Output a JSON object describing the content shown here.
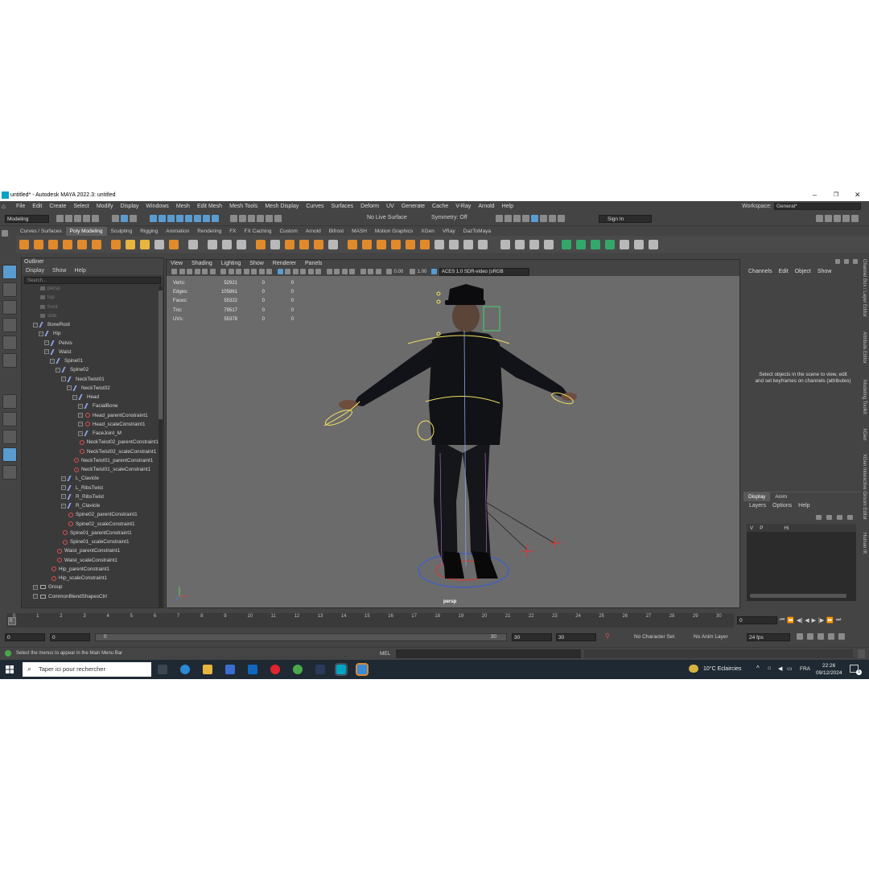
{
  "window": {
    "title": "untitled* - Autodesk MAYA 2022.3: untitled"
  },
  "menubar": {
    "items": [
      "File",
      "Edit",
      "Create",
      "Select",
      "Modify",
      "Display",
      "Windows",
      "Mesh",
      "Edit Mesh",
      "Mesh Tools",
      "Mesh Display",
      "Curves",
      "Surfaces",
      "Deform",
      "UV",
      "Generate",
      "Cache",
      "V-Ray",
      "Arnold",
      "Help"
    ],
    "workspace_label": "Workspace:",
    "workspace_value": "General*"
  },
  "statusline": {
    "mode": "Modeling",
    "live_surface": "No Live Surface",
    "symmetry": "Symmetry: Off",
    "sign_in": "Sign In"
  },
  "shelf": {
    "tabs": [
      "Curves / Surfaces",
      "Poly Modeling",
      "Sculpting",
      "Rigging",
      "Animation",
      "Rendering",
      "FX",
      "FX Caching",
      "Custom",
      "Arnold",
      "Bifrost",
      "MASH",
      "Motion Graphics",
      "XGen",
      "VRay",
      "DazToMaya"
    ],
    "active_tab": "Poly Modeling"
  },
  "outliner": {
    "title": "Outliner",
    "menu": [
      "Display",
      "Show",
      "Help"
    ],
    "search_placeholder": "Search...",
    "items": [
      {
        "label": "persp",
        "depth": 0,
        "kind": "camera",
        "dim": true
      },
      {
        "label": "top",
        "depth": 0,
        "kind": "camera",
        "dim": true
      },
      {
        "label": "front",
        "depth": 0,
        "kind": "camera",
        "dim": true
      },
      {
        "label": "side",
        "depth": 0,
        "kind": "camera",
        "dim": true
      },
      {
        "label": "BoneRoot",
        "depth": 0,
        "kind": "joint",
        "exp": true
      },
      {
        "label": "Hip",
        "depth": 1,
        "kind": "joint",
        "exp": true
      },
      {
        "label": "Pelvis",
        "depth": 2,
        "kind": "joint",
        "exp": true
      },
      {
        "label": "Waist",
        "depth": 2,
        "kind": "joint",
        "exp": true
      },
      {
        "label": "Spine01",
        "depth": 3,
        "kind": "joint",
        "exp": true
      },
      {
        "label": "Spine02",
        "depth": 4,
        "kind": "joint",
        "exp": true
      },
      {
        "label": "NeckTwist01",
        "depth": 5,
        "kind": "joint",
        "exp": true
      },
      {
        "label": "NeckTwist02",
        "depth": 6,
        "kind": "joint",
        "exp": true
      },
      {
        "label": "Head",
        "depth": 7,
        "kind": "joint",
        "exp": true
      },
      {
        "label": "FacialBone",
        "depth": 8,
        "kind": "joint",
        "exp": true
      },
      {
        "label": "Head_parentConstraint1",
        "depth": 8,
        "kind": "constraint",
        "exp": true
      },
      {
        "label": "Head_scaleConstraint1",
        "depth": 8,
        "kind": "constraint",
        "exp": true
      },
      {
        "label": "FaceJoint_M",
        "depth": 8,
        "kind": "joint",
        "exp": true
      },
      {
        "label": "NeckTwist02_parentConstraint1",
        "depth": 7,
        "kind": "constraint"
      },
      {
        "label": "NeckTwist02_scaleConstraint1",
        "depth": 7,
        "kind": "constraint"
      },
      {
        "label": "NeckTwist01_parentConstraint1",
        "depth": 6,
        "kind": "constraint"
      },
      {
        "label": "NeckTwist01_scaleConstraint1",
        "depth": 6,
        "kind": "constraint"
      },
      {
        "label": "L_Clavicle",
        "depth": 5,
        "kind": "joint",
        "exp": true
      },
      {
        "label": "L_RibsTwist",
        "depth": 5,
        "kind": "joint",
        "exp": true
      },
      {
        "label": "R_RibsTwist",
        "depth": 5,
        "kind": "joint",
        "exp": true
      },
      {
        "label": "R_Clavicle",
        "depth": 5,
        "kind": "joint",
        "exp": true
      },
      {
        "label": "Spine02_parentConstraint1",
        "depth": 5,
        "kind": "constraint"
      },
      {
        "label": "Spine02_scaleConstraint1",
        "depth": 5,
        "kind": "constraint"
      },
      {
        "label": "Spine01_parentConstraint1",
        "depth": 4,
        "kind": "constraint"
      },
      {
        "label": "Spine01_scaleConstraint1",
        "depth": 4,
        "kind": "constraint"
      },
      {
        "label": "Waist_parentConstraint1",
        "depth": 3,
        "kind": "constraint"
      },
      {
        "label": "Waist_scaleConstraint1",
        "depth": 3,
        "kind": "constraint"
      },
      {
        "label": "Hip_parentConstraint1",
        "depth": 2,
        "kind": "constraint"
      },
      {
        "label": "Hip_scaleConstraint1",
        "depth": 2,
        "kind": "constraint"
      },
      {
        "label": "Group",
        "depth": 0,
        "kind": "group",
        "exp": true
      },
      {
        "label": "CommonBlendShapesCtrl",
        "depth": 0,
        "kind": "group",
        "exp": true
      }
    ]
  },
  "viewport": {
    "menu": [
      "View",
      "Shading",
      "Lighting",
      "Show",
      "Renderer",
      "Panels"
    ],
    "exposure": "0.00",
    "gamma": "1.00",
    "color_space": "ACES 1.0 SDR-video (sRGB",
    "camera_label": "persp",
    "hud": [
      {
        "label": "Verts:",
        "v1": "52921",
        "v2": "0",
        "v3": "0"
      },
      {
        "label": "Edges:",
        "v1": "105861",
        "v2": "0",
        "v3": "0"
      },
      {
        "label": "Faces:",
        "v1": "55322",
        "v2": "0",
        "v3": "0"
      },
      {
        "label": "Tris:",
        "v1": "79517",
        "v2": "0",
        "v3": "0"
      },
      {
        "label": "UVs:",
        "v1": "55378",
        "v2": "0",
        "v3": "0"
      }
    ]
  },
  "channelbox": {
    "menu": [
      "Channels",
      "Edit",
      "Object",
      "Show"
    ],
    "hint": "Select objects in the scene to view, edit and set keyframes on channels (attributes)"
  },
  "layer_editor": {
    "tabs": [
      "Display",
      "Anim"
    ],
    "menu": [
      "Layers",
      "Options",
      "Help"
    ],
    "layer": {
      "v": "V",
      "p": "P",
      "name": "Hi"
    }
  },
  "side_tabs": [
    "Channel Box / Layer Editor",
    "Attribute Editor",
    "Modeling Toolkit",
    "XGen",
    "XGen Interactive Groom Editor",
    "Human IK"
  ],
  "timeline": {
    "ticks": [
      "0",
      "1",
      "2",
      "3",
      "4",
      "5",
      "6",
      "7",
      "8",
      "9",
      "10",
      "11",
      "12",
      "13",
      "14",
      "15",
      "16",
      "17",
      "18",
      "19",
      "20",
      "21",
      "22",
      "23",
      "24",
      "25",
      "26",
      "27",
      "28",
      "29",
      "30"
    ],
    "current_frame": "0"
  },
  "range": {
    "start": "0",
    "inner_start": "0",
    "slider_start": "0",
    "slider_end": "30",
    "inner_end": "30",
    "end": "30",
    "character_set": "No Character Set",
    "anim_layer": "No Anim Layer",
    "fps": "24 fps"
  },
  "commandline": {
    "help": "Select the menus to appear in the Main Menu Bar",
    "lang": "MEL"
  },
  "taskbar": {
    "search_placeholder": "Taper ici pour rechercher",
    "weather": "10°C  Eclaircies",
    "lang": "FRA",
    "time": "22:26",
    "date": "09/12/2024",
    "notification_count": "1"
  },
  "colors": {
    "accent": "#5a9bd0",
    "maya_logo": "#00a3c4",
    "shelf_orange": "#e08a2b"
  }
}
